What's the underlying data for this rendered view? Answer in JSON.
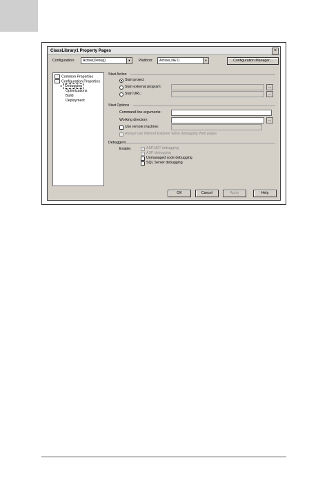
{
  "dialog": {
    "title": "ClassLibrary1 Property Pages",
    "close_glyph": "×"
  },
  "toolbar": {
    "configuration_label": "Configuration:",
    "configuration_value": "Active(Debug)",
    "platform_label": "Platform:",
    "platform_value": "Active(.NET)",
    "config_manager_label": "Configuration Manager..."
  },
  "tree": {
    "items": [
      {
        "label": "Common Properties"
      },
      {
        "label": "Configuration Properties"
      },
      {
        "label": "Debugging"
      },
      {
        "label": "Optimizations"
      },
      {
        "label": "Build"
      },
      {
        "label": "Deployment"
      }
    ]
  },
  "start_action": {
    "header": "Start Action",
    "start_project": "Start project",
    "start_external": "Start external program:",
    "start_url": "Start URL:",
    "browse_glyph": "..."
  },
  "start_options": {
    "header": "Start Options",
    "command_line_label": "Command line arguments:",
    "working_dir_label": "Working directory:",
    "use_remote_label": "Use remote machine:",
    "always_use_ie": "Always use Internet Explorer when debugging Web pages"
  },
  "debuggers": {
    "header": "Debuggers",
    "enable_label": "Enable:",
    "aspnet": "ASP.NET debugging",
    "asp": "ASP debugging",
    "unmanaged": "Unmanaged code debugging",
    "sql": "SQL Server debugging"
  },
  "buttons": {
    "ok": "OK",
    "cancel": "Cancel",
    "apply": "Apply",
    "help": "Help"
  }
}
